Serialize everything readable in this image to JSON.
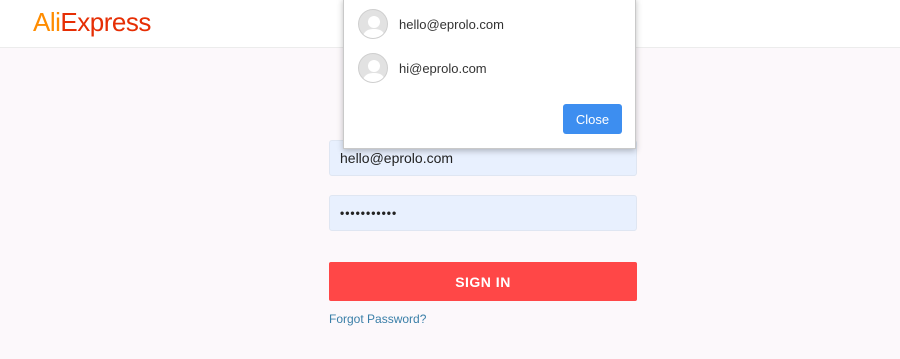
{
  "header": {
    "logo_part1": "Ali",
    "logo_part2": "Express"
  },
  "popup": {
    "accounts": [
      {
        "email": "hello@eprolo.com",
        "icon": "avatar-icon"
      },
      {
        "email": "hi@eprolo.com",
        "icon": "avatar-icon"
      }
    ],
    "close_label": "Close"
  },
  "login": {
    "email_value": "hello@eprolo.com",
    "password_value": "•••••••••••",
    "signin_label": "SIGN IN",
    "forgot_label": "Forgot Password?"
  },
  "colors": {
    "brand_orange": "#ff8c00",
    "brand_red": "#e62e04",
    "signin_button": "#ff4747",
    "close_button": "#3d8ef0",
    "autofill_bg": "#e8f0fe",
    "link": "#3a7fa8"
  }
}
